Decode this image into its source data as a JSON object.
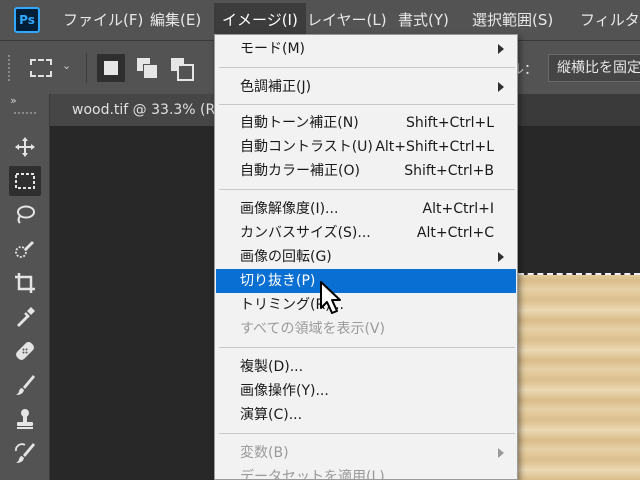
{
  "menubar": {
    "logo": "Ps",
    "items": [
      {
        "label": "ファイル(F)"
      },
      {
        "label": "編集(E)"
      },
      {
        "label": "イメージ(I)"
      },
      {
        "label": "レイヤー(L)"
      },
      {
        "label": "書式(Y)"
      },
      {
        "label": "選択範囲(S)"
      },
      {
        "label": "フィルター"
      }
    ]
  },
  "options": {
    "style_label": "ル：",
    "style_value": "縦横比を固定"
  },
  "toolbar": {
    "collapse": "»",
    "tools": [
      {
        "name": "move-tool-icon"
      },
      {
        "name": "rectangular-marquee-tool-icon"
      },
      {
        "name": "lasso-tool-icon"
      },
      {
        "name": "quick-selection-tool-icon"
      },
      {
        "name": "crop-tool-icon"
      },
      {
        "name": "eyedropper-tool-icon"
      },
      {
        "name": "healing-brush-tool-icon"
      },
      {
        "name": "brush-tool-icon"
      },
      {
        "name": "clone-stamp-tool-icon"
      },
      {
        "name": "history-brush-tool-icon"
      }
    ]
  },
  "document": {
    "tab_title": "wood.tif @ 33.3% (R"
  },
  "image_menu": {
    "items": [
      {
        "label": "モード(M)",
        "shortcut": "",
        "submenu": true,
        "disabled": false
      },
      {
        "label": "色調補正(J)",
        "shortcut": "",
        "submenu": true,
        "disabled": false
      },
      {
        "label": "自動トーン補正(N)",
        "shortcut": "Shift+Ctrl+L",
        "submenu": false,
        "disabled": false
      },
      {
        "label": "自動コントラスト(U)",
        "shortcut": "Alt+Shift+Ctrl+L",
        "submenu": false,
        "disabled": false
      },
      {
        "label": "自動カラー補正(O)",
        "shortcut": "Shift+Ctrl+B",
        "submenu": false,
        "disabled": false
      },
      {
        "label": "画像解像度(I)...",
        "shortcut": "Alt+Ctrl+I",
        "submenu": false,
        "disabled": false
      },
      {
        "label": "カンバスサイズ(S)...",
        "shortcut": "Alt+Ctrl+C",
        "submenu": false,
        "disabled": false
      },
      {
        "label": "画像の回転(G)",
        "shortcut": "",
        "submenu": true,
        "disabled": false
      },
      {
        "label": "切り抜き(P)",
        "shortcut": "",
        "submenu": false,
        "disabled": false,
        "highlighted": true
      },
      {
        "label": "トリミング(R)...",
        "shortcut": "",
        "submenu": false,
        "disabled": false
      },
      {
        "label": "すべての領域を表示(V)",
        "shortcut": "",
        "submenu": false,
        "disabled": true
      },
      {
        "label": "複製(D)...",
        "shortcut": "",
        "submenu": false,
        "disabled": false
      },
      {
        "label": "画像操作(Y)...",
        "shortcut": "",
        "submenu": false,
        "disabled": false
      },
      {
        "label": "演算(C)...",
        "shortcut": "",
        "submenu": false,
        "disabled": false
      },
      {
        "label": "変数(B)",
        "shortcut": "",
        "submenu": true,
        "disabled": true
      },
      {
        "label": "データセットを適用(L)...",
        "shortcut": "",
        "submenu": false,
        "disabled": true
      }
    ]
  },
  "colors": {
    "highlight": "#0a6fd2",
    "menubar_bg": "#535353",
    "canvas_bg": "#282828",
    "menu_bg": "#f2f2f2"
  }
}
